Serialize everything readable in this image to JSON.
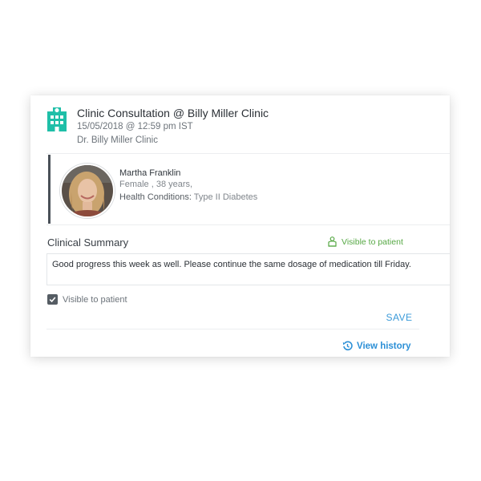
{
  "consultation": {
    "title": "Clinic Consultation @ Billy Miller Clinic",
    "datetime": "15/05/2018 @ 12:59 pm IST",
    "doctor": "Dr. Billy Miller Clinic",
    "icon": "hospital-icon",
    "icon_color": "#1fbfa8"
  },
  "patient": {
    "name": "Martha Franklin",
    "details": "Female , 38 years,",
    "conditions_label": "Health Conditions:",
    "conditions_value": "Type II Diabetes",
    "avatar_icon": "patient-photo"
  },
  "summary": {
    "title": "Clinical Summary",
    "visibility_badge": "Visible to patient",
    "visibility_color": "#56a844",
    "text": "Good progress this week as well. Please continue the same dosage of medication till Friday.",
    "checkbox_label": "Visible to patient",
    "checkbox_checked": true
  },
  "actions": {
    "save_label": "SAVE",
    "history_label": "View history",
    "accent_color": "#3a9ad9"
  }
}
